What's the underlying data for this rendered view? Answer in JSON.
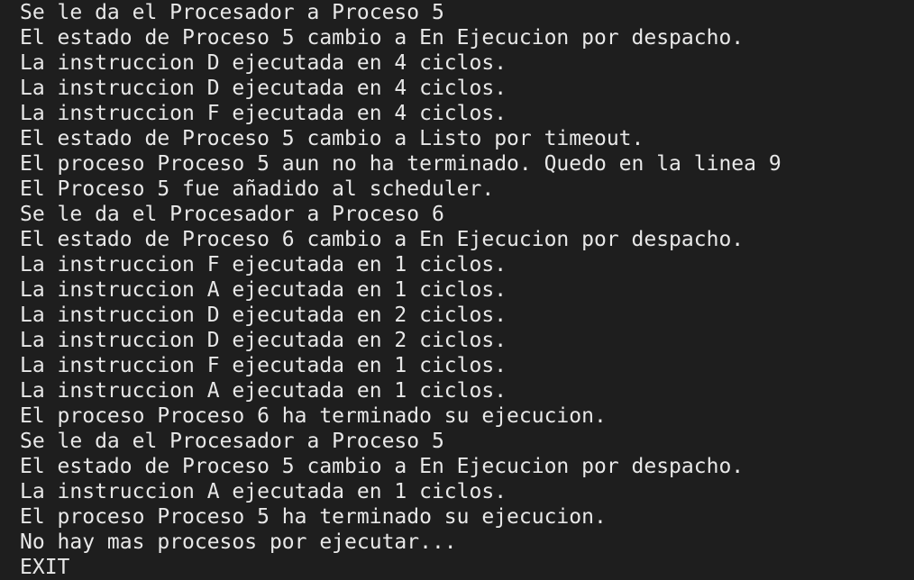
{
  "terminal": {
    "lines": [
      "Se le da el Procesador a Proceso 5",
      "El estado de Proceso 5 cambio a En Ejecucion por despacho.",
      "La instruccion D ejecutada en 4 ciclos.",
      "La instruccion D ejecutada en 4 ciclos.",
      "La instruccion F ejecutada en 4 ciclos.",
      "El estado de Proceso 5 cambio a Listo por timeout.",
      "El proceso Proceso 5 aun no ha terminado. Quedo en la linea 9",
      "El Proceso 5 fue añadido al scheduler.",
      "Se le da el Procesador a Proceso 6",
      "El estado de Proceso 6 cambio a En Ejecucion por despacho.",
      "La instruccion F ejecutada en 1 ciclos.",
      "La instruccion A ejecutada en 1 ciclos.",
      "La instruccion D ejecutada en 2 ciclos.",
      "La instruccion D ejecutada en 2 ciclos.",
      "La instruccion F ejecutada en 1 ciclos.",
      "La instruccion A ejecutada en 1 ciclos.",
      "El proceso Proceso 6 ha terminado su ejecucion.",
      "Se le da el Procesador a Proceso 5",
      "El estado de Proceso 5 cambio a En Ejecucion por despacho.",
      "La instruccion A ejecutada en 1 ciclos.",
      "El proceso Proceso 5 ha terminado su ejecucion.",
      "No hay mas procesos por ejecutar...",
      "EXIT"
    ],
    "colors": {
      "background": "#1e1e1e",
      "text": "#e8e8e8"
    }
  }
}
